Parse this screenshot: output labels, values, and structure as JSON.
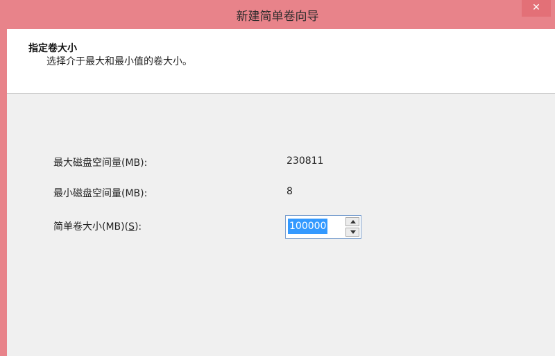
{
  "window": {
    "title": "新建简单卷向导",
    "close_glyph": "✕"
  },
  "header": {
    "title": "指定卷大小",
    "subtitle": "选择介于最大和最小值的卷大小。"
  },
  "fields": {
    "max_label": "最大磁盘空间量(MB):",
    "max_value": "230811",
    "min_label": "最小磁盘空间量(MB):",
    "min_value": "8",
    "size_label_prefix": "简单卷大小(MB)(",
    "size_label_accel": "S",
    "size_label_suffix": "):",
    "size_value": "100000"
  },
  "colors": {
    "titlebar": "#e8838a",
    "selection": "#3399ff"
  },
  "icons": {
    "close": "close-icon",
    "spin_up": "triangle-up-icon",
    "spin_down": "triangle-down-icon"
  }
}
